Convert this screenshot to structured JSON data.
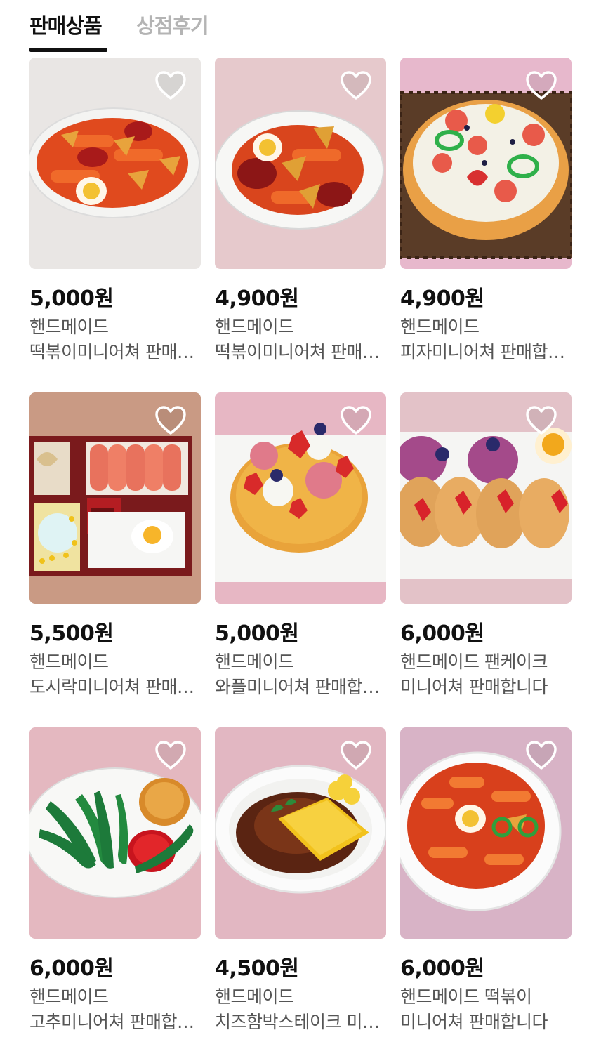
{
  "tabs": {
    "active_label": "판매상품",
    "inactive_label": "상점후기"
  },
  "colors": {
    "tab_active": "#111111",
    "tab_inactive": "#b4b4b4",
    "price": "#111111",
    "desc": "#555555"
  },
  "products": [
    {
      "price": "5,000원",
      "line1": "핸드메이드",
      "line2": "떡볶이미니어쳐 판매합니다",
      "heart_icon": "heart-outline-icon"
    },
    {
      "price": "4,900원",
      "line1": "핸드메이드",
      "line2": "떡볶이미니어쳐 판매합니다",
      "heart_icon": "heart-outline-icon"
    },
    {
      "price": "4,900원",
      "line1": "핸드메이드",
      "line2": "피자미니어쳐  판매합니다",
      "heart_icon": "heart-outline-icon"
    },
    {
      "price": "5,500원",
      "line1": "핸드메이드",
      "line2": "도시락미니어쳐 판매합니다",
      "heart_icon": "heart-outline-icon"
    },
    {
      "price": "5,000원",
      "line1": "핸드메이드",
      "line2": "와플미니어쳐 판매합니다",
      "heart_icon": "heart-outline-icon"
    },
    {
      "price": "6,000원",
      "line1": "핸드메이드 팬케이크",
      "line2": "미니어쳐 판매합니다",
      "heart_icon": "heart-outline-icon"
    },
    {
      "price": "6,000원",
      "line1": "핸드메이드",
      "line2": "고추미니어쳐 판매합니다",
      "heart_icon": "heart-outline-icon"
    },
    {
      "price": "4,500원",
      "line1": "핸드메이드",
      "line2": "치즈함박스테이크 미니어쳐",
      "heart_icon": "heart-outline-icon"
    },
    {
      "price": "6,000원",
      "line1": "핸드메이드 떡볶이",
      "line2": "미니어쳐 판매합니다",
      "heart_icon": "heart-outline-icon"
    }
  ]
}
